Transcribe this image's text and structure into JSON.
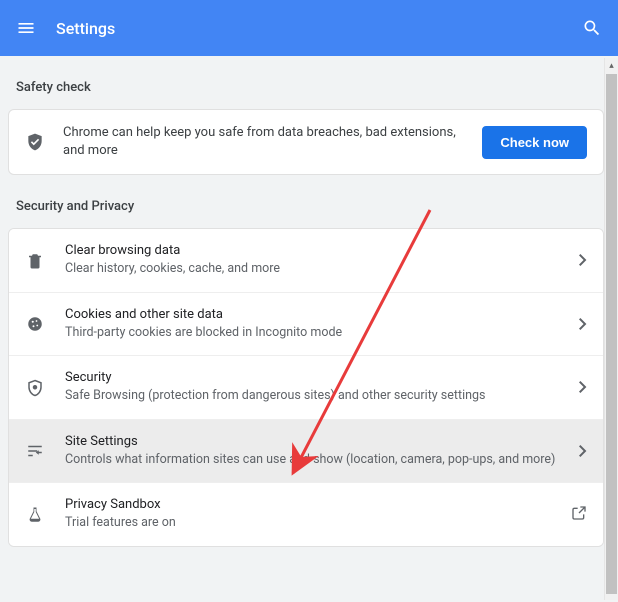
{
  "header": {
    "title": "Settings"
  },
  "safety": {
    "section": "Safety check",
    "text": "Chrome can help keep you safe from data breaches, bad extensions, and more",
    "button": "Check now"
  },
  "privacy": {
    "section": "Security and Privacy",
    "items": [
      {
        "title": "Clear browsing data",
        "sub": "Clear history, cookies, cache, and more"
      },
      {
        "title": "Cookies and other site data",
        "sub": "Third-party cookies are blocked in Incognito mode"
      },
      {
        "title": "Security",
        "sub": "Safe Browsing (protection from dangerous sites) and other security settings"
      },
      {
        "title": "Site Settings",
        "sub": "Controls what information sites can use and show (location, camera, pop-ups, and more)"
      },
      {
        "title": "Privacy Sandbox",
        "sub": "Trial features are on"
      }
    ]
  }
}
